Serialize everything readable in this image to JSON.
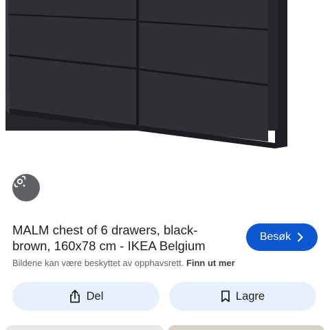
{
  "result": {
    "title": "MALM chest of 6 drawers, black-brown, 160x78 cm - IKEA Belgium",
    "visit_label": "Besøk",
    "copyright_text": "Bildene kan være beskyttet av opphavsrett.",
    "learn_more_label": "Finn ut mer"
  },
  "actions": {
    "share_label": "Del",
    "save_label": "Lagre"
  },
  "icons": {
    "lens": "google-lens-icon",
    "visit_chevron": "chevron-right-icon",
    "share": "share-icon",
    "save": "bookmark-icon"
  },
  "colors": {
    "accent": "#0b57d0",
    "pill_background": "#e8f0fe",
    "furniture": "#2b2c30"
  }
}
